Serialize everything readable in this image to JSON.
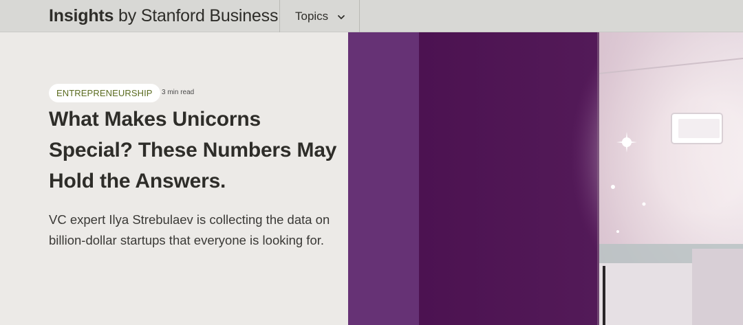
{
  "header": {
    "brand_strong": "Insights",
    "brand_rest": " by Stanford Business",
    "topics_label": "Topics",
    "chevron_icon": "chevron-down-icon"
  },
  "article": {
    "category": "ENTREPRENEURSHIP",
    "read_time": "3 min read",
    "title": "What Makes Unicorns Special? These Numbers May Hold the Answers.",
    "dek": "VC expert Ilya Strebulaev is collecting the data on billion-dollar startups that everyone is looking for."
  },
  "colors": {
    "header_bg": "#d8d8d5",
    "page_bg": "#eceae7",
    "tag_text": "#5a6b1f",
    "purple_light": "#663275",
    "purple_dark": "#4a1250"
  }
}
